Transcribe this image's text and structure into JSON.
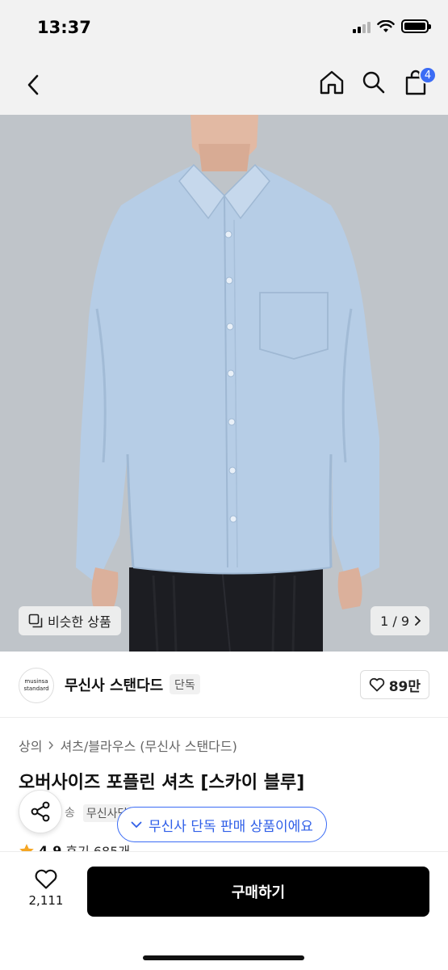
{
  "status_bar": {
    "time": "13:37"
  },
  "nav": {
    "cart_count": "4"
  },
  "image": {
    "similar_label": "비슷한 상품",
    "page_counter": "1 / 9",
    "colors": {
      "shirt": "#b6cde6",
      "background": "#bfc4c9",
      "trousers": "#1c1d22"
    }
  },
  "brand": {
    "logo_line1": "musinsa",
    "logo_line2": "standard",
    "name": "무신사 스탠다드",
    "tag": "단독",
    "likes": "89만"
  },
  "product": {
    "breadcrumb": [
      "상의",
      "셔츠/블라우스 (무신사 스탠다드)"
    ],
    "title": "오버사이즈 포플린 셔츠 [스카이 블루]",
    "delivery_fragment": "송",
    "delivery_chip": "무신사단",
    "rating": "4.9",
    "review_label": "후기 685개"
  },
  "toast": {
    "text": "무신사 단독 판매 상품이에요"
  },
  "bottom_bar": {
    "wish_count": "2,111",
    "buy_label": "구매하기",
    "buy_color": "#000000"
  },
  "accent_color": "#3b6cf5"
}
